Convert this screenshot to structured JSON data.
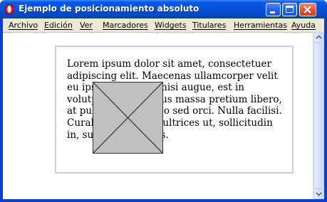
{
  "window": {
    "title": "Ejemplo de posicionamiento absoluto",
    "app_icon": "opera-logo-icon",
    "titlebar_color": "#0653d8",
    "close_color": "#e35d35"
  },
  "menubar": {
    "items": [
      {
        "label": "Archivo"
      },
      {
        "label": "Edición"
      },
      {
        "label": "Ver"
      },
      {
        "label": "Marcadores"
      },
      {
        "label": "Widgets"
      },
      {
        "label": "Titulares"
      },
      {
        "label": "Herramientas"
      },
      {
        "label": "Ayuda"
      }
    ]
  },
  "content": {
    "paragraph": "Lorem ipsum dolor sit amet, consectetuer adipiscing elit. Maecenas ullamcorper velit eu ipsum. Nam vel nisi augue, est in volutpat cursus, risus massa pretium libero, at pulvinar turpis leo sed orci. Nulla facilisi. Curabitur felis dui, ultrices ut, sollicitudin in, suscipit at, tellus.",
    "overlay_box_color": "#c0c0c0"
  },
  "scrollbar": {
    "up_icon": "arrow-up-icon",
    "down_icon": "arrow-down-icon"
  }
}
